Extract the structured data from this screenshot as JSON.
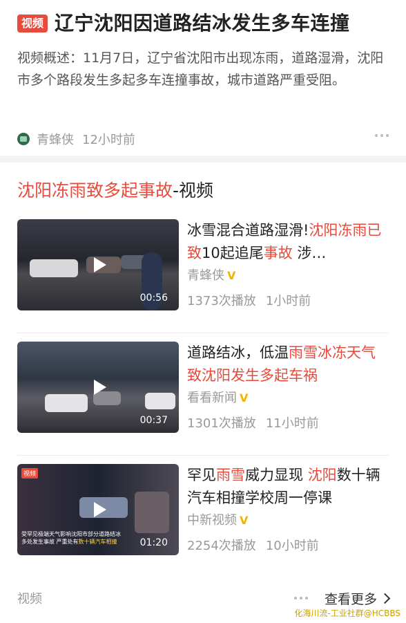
{
  "header": {
    "badge": "视频",
    "title": "辽宁沈阳因道路结冰发生多车连撞",
    "summary": "视频概述：11月7日，辽宁省沈阳市出现冻雨，道路湿滑，沈阳市多个路段发生多起多车连撞事故，城市道路严重受阻。",
    "source": "青蜂侠",
    "time": "12小时前"
  },
  "section": {
    "title_red": "沈阳冻雨致多起事故",
    "title_rest": "-视频"
  },
  "items": [
    {
      "title_parts": [
        "冰雪混合道路湿滑!",
        "沈阳冻雨已致",
        "10起追尾",
        "事故",
        " 涉…"
      ],
      "source": "青蜂侠",
      "plays": "1373次播放",
      "time": "1小时前",
      "duration": "00:56"
    },
    {
      "title_parts": [
        "道路结冰，低温",
        "雨雪冰冻天气致沈阳发生多起车祸"
      ],
      "source": "看看新闻",
      "plays": "1301次播放",
      "time": "11小时前",
      "duration": "00:37"
    },
    {
      "title_parts": [
        "罕见",
        "雨雪",
        "威力显现 ",
        "沈阳",
        "数十辆汽车相撞学校周一停课"
      ],
      "source": "中新视频",
      "plays": "2254次播放",
      "time": "10小时前",
      "duration": "01:20",
      "caption_badge": "视频",
      "caption_line1": "受罕见极端天气影响沈阳市部分道路结冰",
      "caption_line2": "多处发生事故 严重处有",
      "caption_highlight": "数十辆汽车相撞"
    }
  ],
  "footer": {
    "label": "视频",
    "more": "查看更多"
  },
  "verified_mark": "V",
  "watermark": "化海川流-工业社群@HCBBS",
  "colors": {
    "accent": "#e84a3c",
    "verified": "#f0b400"
  }
}
